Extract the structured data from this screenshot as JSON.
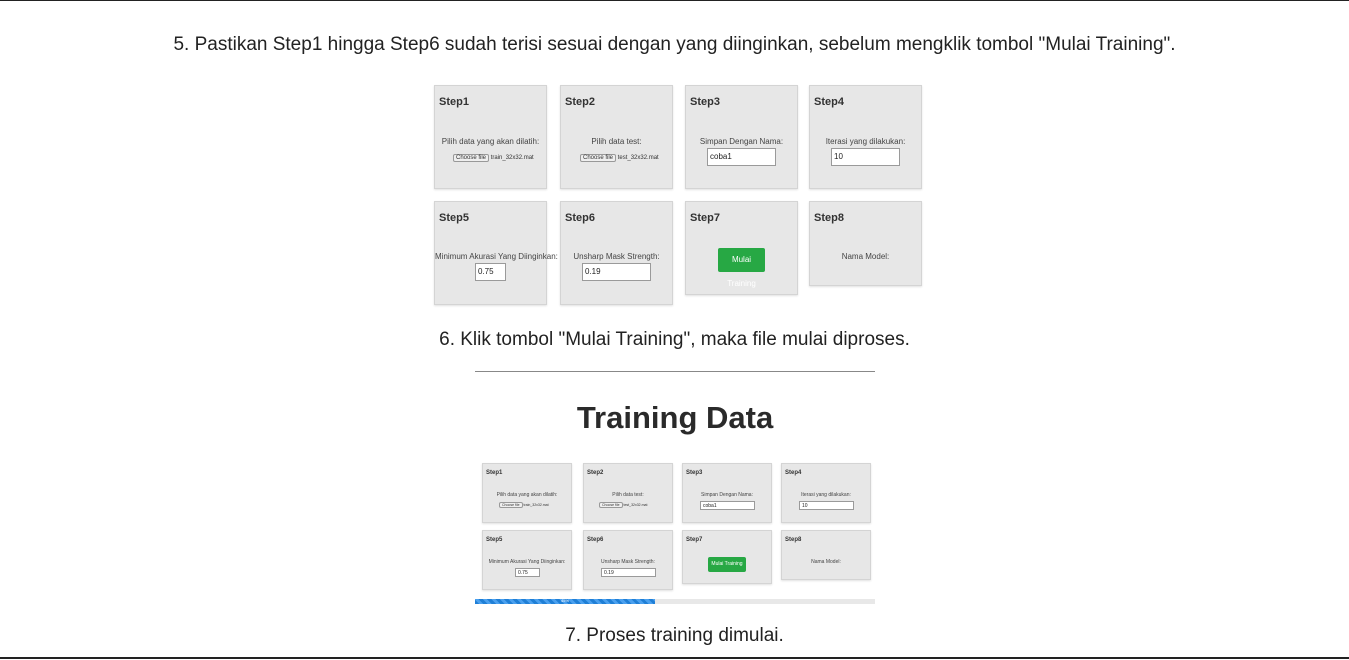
{
  "captions": {
    "step5": "5. Pastikan Step1 hingga Step6 sudah terisi sesuai dengan yang diinginkan, sebelum mengklik tombol \"Mulai Training\".",
    "step6": "6. Klik tombol \"Mulai Training\", maka file mulai diproses.",
    "step7": "7. Proses training dimulai."
  },
  "form": {
    "step1": {
      "title": "Step1",
      "label": "Pilih data yang akan dilatih:",
      "file_button": "Choose file",
      "file_name": "train_32x32.mat"
    },
    "step2": {
      "title": "Step2",
      "label": "Pilih data test:",
      "file_button": "Choose file",
      "file_name": "test_32x32.mat"
    },
    "step3": {
      "title": "Step3",
      "label": "Simpan Dengan Nama:",
      "value": "coba1"
    },
    "step4": {
      "title": "Step4",
      "label": "Iterasi yang dilakukan:",
      "value": "10"
    },
    "step5": {
      "title": "Step5",
      "label": "Minimum Akurasi Yang Diinginkan:",
      "value": "0.75"
    },
    "step6": {
      "title": "Step6",
      "label": "Unsharp Mask Strength:",
      "value": "0.19"
    },
    "step7": {
      "title": "Step7",
      "button": "Mulai Training"
    },
    "step8": {
      "title": "Step8",
      "label": "Nama Model:"
    }
  },
  "figure2": {
    "title": "Training Data",
    "progress_label": "45%",
    "progress_fraction": 0.45
  },
  "colors": {
    "card_bg": "#e7e7e7",
    "button_green": "#27a844",
    "progress_blue": "#1f7fd6"
  }
}
